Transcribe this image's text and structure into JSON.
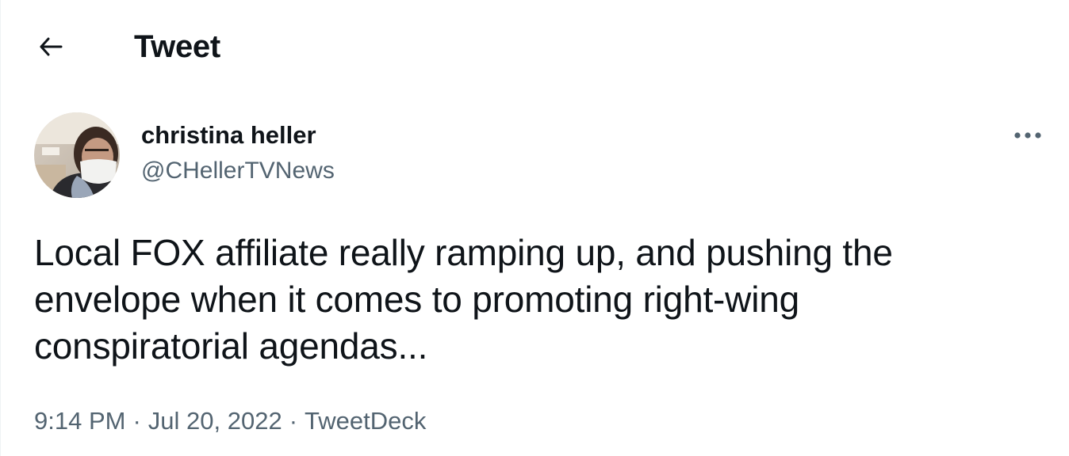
{
  "header": {
    "back_icon": "arrow-left-icon",
    "title": "Tweet"
  },
  "author": {
    "avatar_icon": "user-avatar",
    "name": "christina heller",
    "handle": "@CHellerTVNews",
    "more_icon": "more-horizontal-icon"
  },
  "tweet": {
    "text": "Local FOX affiliate really ramping up, and pushing the\nenvelope when it comes to promoting right-wing\nconspiratorial agendas..."
  },
  "meta": {
    "time": "9:14 PM",
    "date": "Jul 20, 2022",
    "source": "TweetDeck",
    "separator": "·"
  },
  "colors": {
    "text_primary": "#0f1419",
    "text_secondary": "#536471",
    "background": "#ffffff"
  }
}
